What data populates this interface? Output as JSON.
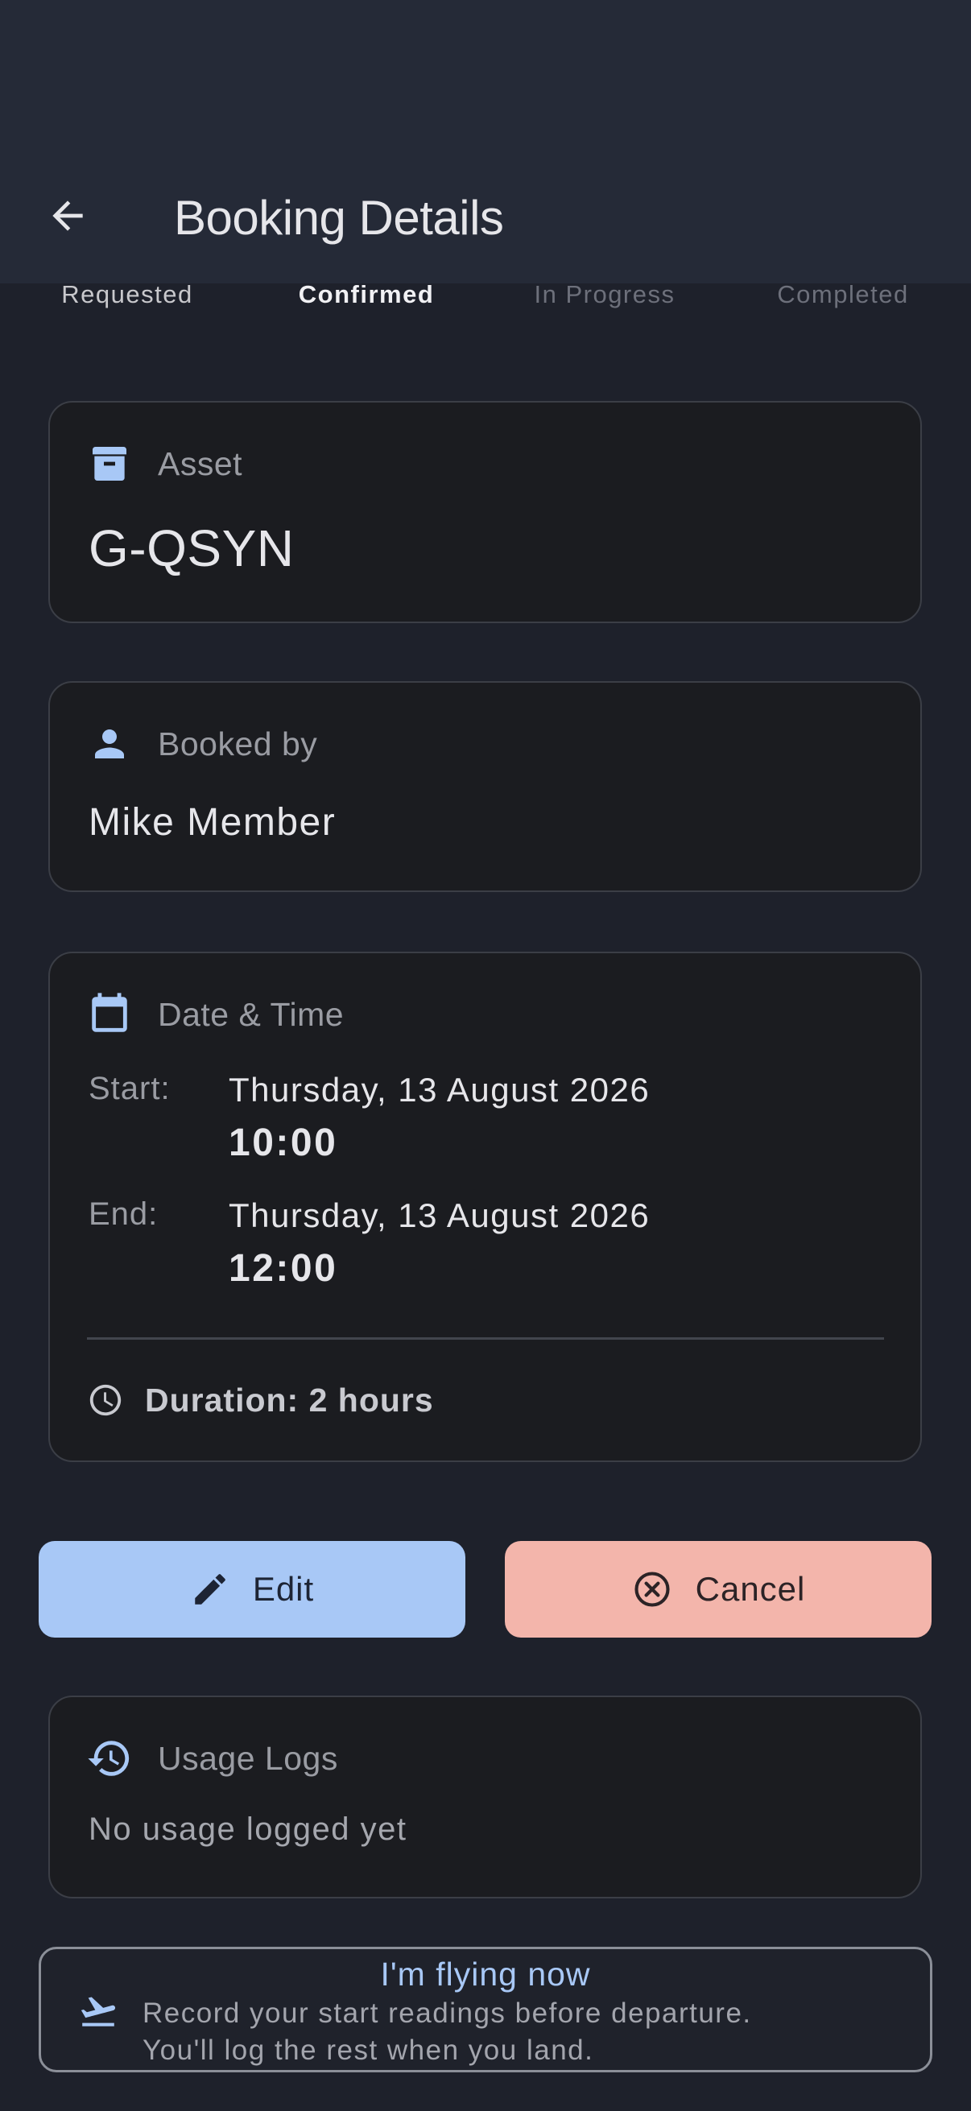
{
  "header": {
    "title": "Booking Details",
    "back_icon": "arrow-back-icon"
  },
  "status_steps": [
    {
      "label": "Requested",
      "state": "done"
    },
    {
      "label": "Confirmed",
      "state": "active"
    },
    {
      "label": "In Progress",
      "state": "pending"
    },
    {
      "label": "Completed",
      "state": "pending"
    }
  ],
  "asset": {
    "icon": "archive-icon",
    "label": "Asset",
    "value": "G-QSYN"
  },
  "booked_by": {
    "icon": "person-icon",
    "label": "Booked by",
    "value": "Mike Member"
  },
  "date_time": {
    "icon": "calendar-icon",
    "label": "Date & Time",
    "start_label": "Start:",
    "start_date": "Thursday, 13 August 2026",
    "start_time": "10:00",
    "end_label": "End:",
    "end_date": "Thursday, 13 August 2026",
    "end_time": "12:00",
    "duration_icon": "clock-icon",
    "duration": "Duration: 2 hours"
  },
  "actions": {
    "edit_label": "Edit",
    "edit_icon": "pencil-icon",
    "cancel_label": "Cancel",
    "cancel_icon": "cancel-circle-icon"
  },
  "usage_logs": {
    "icon": "history-icon",
    "label": "Usage Logs",
    "empty_text": "No usage logged yet"
  },
  "flying_now": {
    "icon": "flight-takeoff-icon",
    "title": "I'm flying now",
    "line1": "Record your start readings before departure.",
    "line2": "You'll log the rest when you land."
  },
  "colors": {
    "background": "#1e212b",
    "app_bar": "#252a37",
    "card": "#1b1c20",
    "accent_blue": "#a8c8f6",
    "cancel_salmon": "#f3b5ab"
  }
}
